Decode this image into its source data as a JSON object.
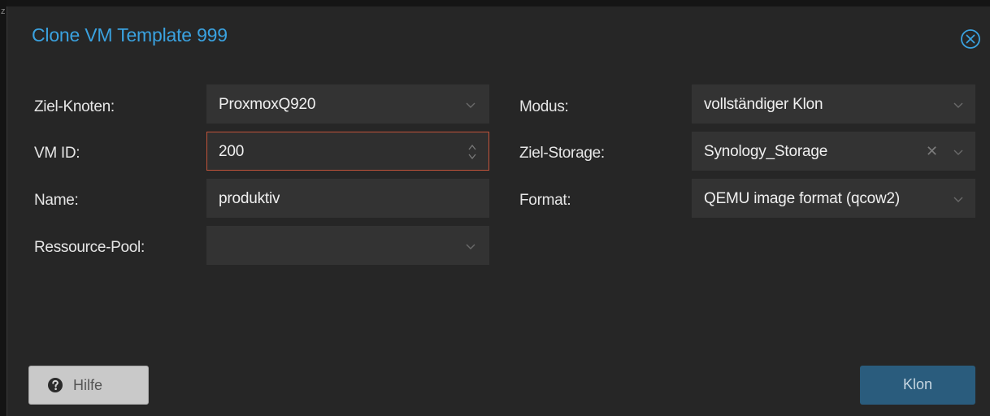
{
  "dialog": {
    "title": "Clone VM Template 999"
  },
  "form": {
    "left": [
      {
        "label": "Ziel-Knoten:",
        "value": "ProxmoxQ920",
        "type": "combo"
      },
      {
        "label": "VM ID:",
        "value": "200",
        "type": "spinner"
      },
      {
        "label": "Name:",
        "value": "produktiv",
        "type": "text"
      },
      {
        "label": "Ressource-Pool:",
        "value": "",
        "type": "combo"
      }
    ],
    "right": [
      {
        "label": "Modus:",
        "value": "vollständiger Klon",
        "type": "combo"
      },
      {
        "label": "Ziel-Storage:",
        "value": "Synology_Storage",
        "type": "combo-clearable"
      },
      {
        "label": "Format:",
        "value": "QEMU image format (qcow2)",
        "type": "combo"
      }
    ]
  },
  "buttons": {
    "help_label": "Hilfe",
    "clone_label": "Klon"
  },
  "icons": {
    "close": "close-icon",
    "help": "question-circle-icon",
    "chevron": "chevron-down-icon",
    "spinner": "spinner-arrows-icon",
    "clear": "clear-x-icon"
  },
  "colors": {
    "title": "#3aa2e0",
    "focus_border": "#c0533a",
    "primary_button": "#2a5c7d"
  }
}
